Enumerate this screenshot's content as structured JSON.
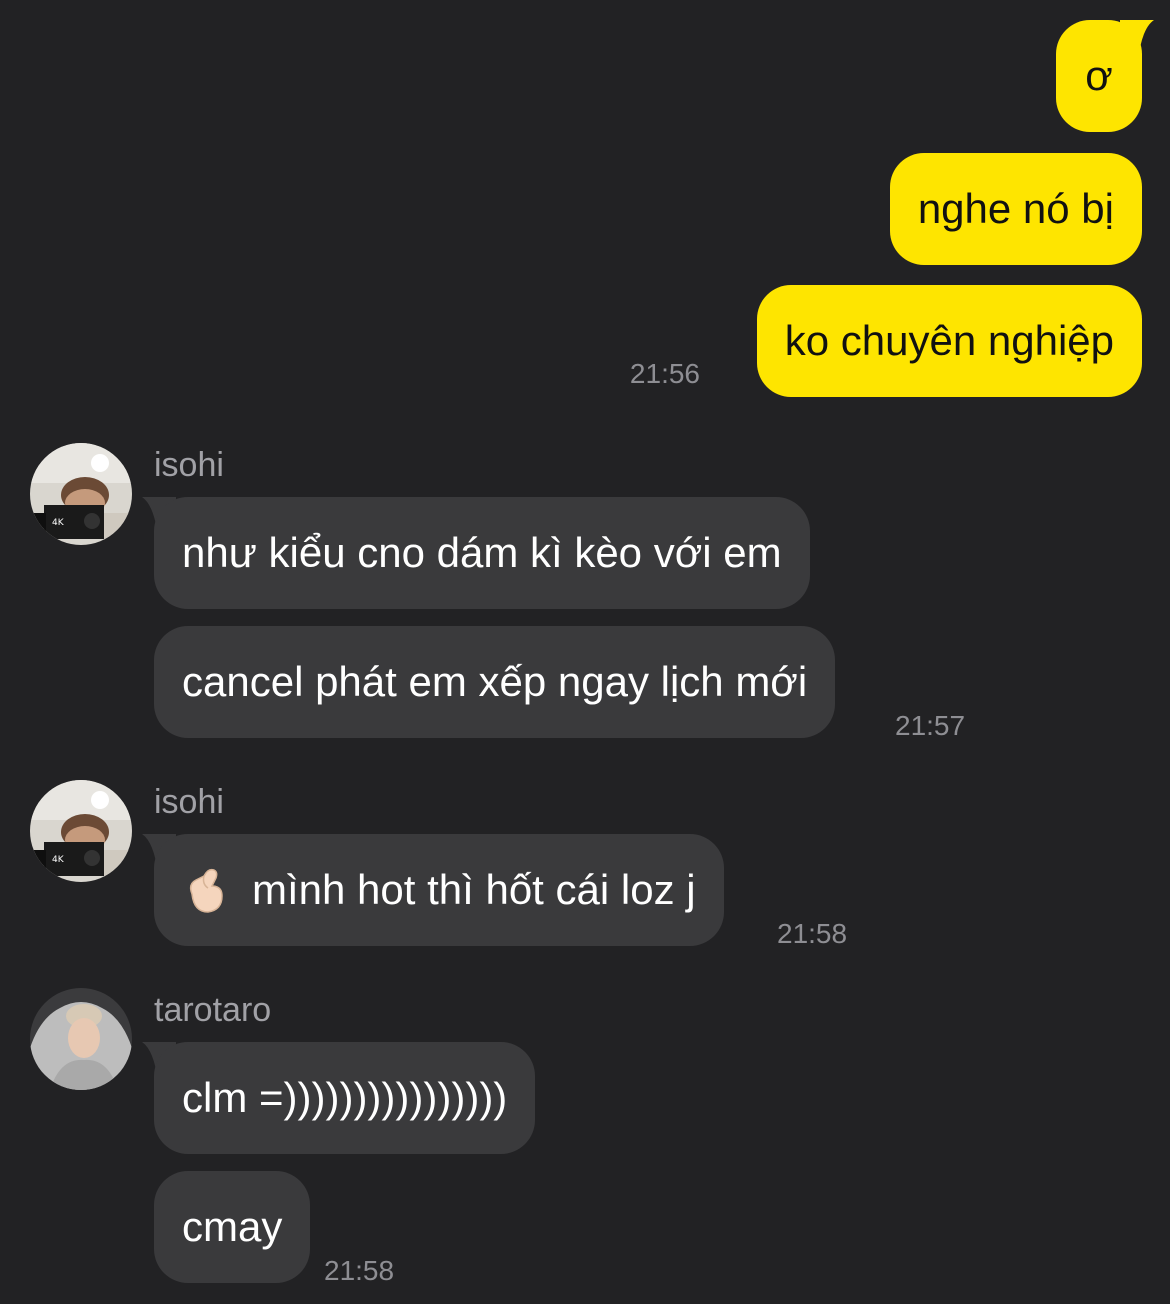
{
  "conversation": {
    "outgoing": [
      {
        "text": "ơ"
      },
      {
        "text": "nghe nó bị"
      },
      {
        "text": "ko chuyên nghiệp",
        "time": "21:56"
      }
    ],
    "groups": [
      {
        "sender": "isohi",
        "avatar_icon": "avatar-photo-camera-person-icon",
        "messages": [
          {
            "text": "như kiểu cno dám kì kèo với em"
          },
          {
            "text": "cancel phát em xếp ngay lịch mới",
            "time": "21:57"
          }
        ]
      },
      {
        "sender": "isohi",
        "avatar_icon": "avatar-photo-camera-person-icon",
        "messages": [
          {
            "emoji_icon": "finger-heart-emoji-icon",
            "text": "mình hot thì hốt cái loz j",
            "time": "21:58"
          }
        ]
      },
      {
        "sender": "tarotaro",
        "avatar_icon": "avatar-photo-hoodie-person-icon",
        "messages": [
          {
            "text": "clm =))))))))))))))))"
          },
          {
            "text": "cmay",
            "time": "21:58"
          }
        ]
      }
    ]
  },
  "colors": {
    "background": "#222224",
    "outgoing_bubble": "#fee500",
    "incoming_bubble": "#3a3a3c",
    "timestamp": "#8e8e93",
    "sender_name": "#a1a1a6"
  }
}
